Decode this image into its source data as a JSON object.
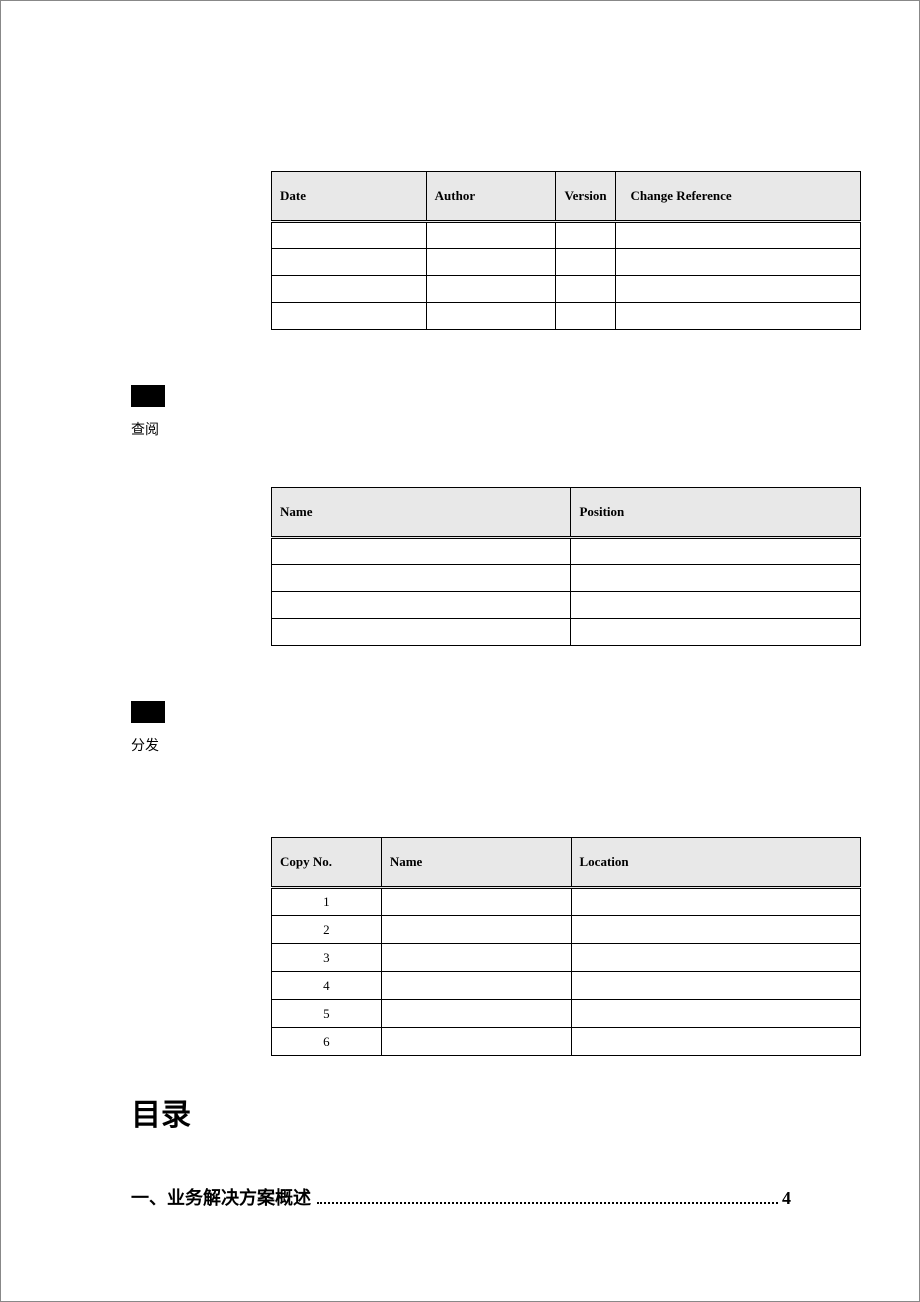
{
  "table1": {
    "headers": [
      "Date",
      "Author",
      "Version",
      "Change Reference"
    ],
    "rows": [
      [
        "",
        "",
        "",
        ""
      ],
      [
        "",
        "",
        "",
        ""
      ],
      [
        "",
        "",
        "",
        ""
      ],
      [
        "",
        "",
        "",
        ""
      ]
    ]
  },
  "section1": {
    "label": "查阅"
  },
  "table2": {
    "headers": [
      "Name",
      "Position"
    ],
    "rows": [
      [
        "",
        ""
      ],
      [
        "",
        ""
      ],
      [
        "",
        ""
      ],
      [
        "",
        ""
      ]
    ]
  },
  "section2": {
    "label": "分发"
  },
  "table3": {
    "headers": [
      "Copy No.",
      "Name",
      "Location"
    ],
    "rows": [
      [
        "1",
        "",
        ""
      ],
      [
        "2",
        "",
        ""
      ],
      [
        "3",
        "",
        ""
      ],
      [
        "4",
        "",
        ""
      ],
      [
        "5",
        "",
        ""
      ],
      [
        "6",
        "",
        ""
      ]
    ]
  },
  "toc": {
    "title": "目录",
    "entries": [
      {
        "text": "一、业务解决方案概述",
        "page": "4"
      }
    ]
  }
}
